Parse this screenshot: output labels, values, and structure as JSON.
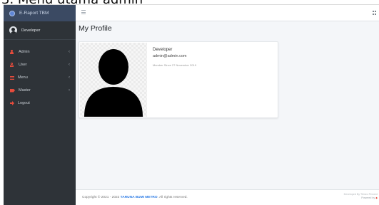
{
  "doc_heading": "3.  Menu utama admin",
  "brand": {
    "title": "E-Raport TBM",
    "logo_icon": "school-logo-icon"
  },
  "user_panel": {
    "name": "Developer"
  },
  "sidebar": {
    "items": [
      {
        "label": "Admin",
        "icon": "user-tie-icon",
        "chevron": "‹"
      },
      {
        "label": "User",
        "icon": "user-outline-icon",
        "chevron": "‹"
      },
      {
        "label": "Menu",
        "icon": "menu-icon",
        "chevron": "‹"
      },
      {
        "label": "Master",
        "icon": "tag-icon",
        "chevron": "‹"
      },
      {
        "label": "Logout",
        "icon": "logout-icon"
      }
    ]
  },
  "page": {
    "title": "My Profile"
  },
  "profile": {
    "name": "Developer",
    "email": "admin@admin.com",
    "member_since": "Member Since 27 November 2019"
  },
  "footer": {
    "copyright_prefix": "Copyright © 2021 - 2022 ",
    "brand": "TARUNA BUMI METRO",
    "copyright_suffix": ". All rights reserved.",
    "developer_line": "Developed By Tiimeo Percent",
    "powered_line": "Powered by"
  },
  "colors": {
    "sidebar_bg": "#2e3338",
    "brand_bg": "#3b4a63",
    "accent": "#e74c3c",
    "link": "#2c7be5"
  }
}
